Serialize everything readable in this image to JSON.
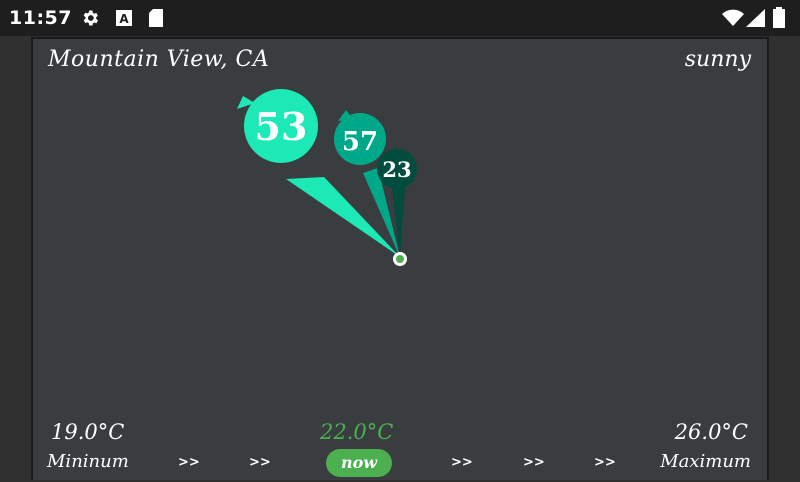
{
  "status_bar": {
    "time": "11:57",
    "icons": [
      "gear-icon",
      "font-a-icon",
      "sd-card-icon",
      "wifi-icon",
      "signal-icon",
      "battery-icon"
    ]
  },
  "weather": {
    "location": "Mountain View, CA",
    "condition": "sunny",
    "pins": [
      {
        "value": "53",
        "color": "#1de9b6"
      },
      {
        "value": "57",
        "color": "#00a88a"
      },
      {
        "value": "23",
        "color": "#004d40"
      }
    ],
    "center_dot_color": "#4caf50",
    "min_temp": "19.0°C",
    "now_temp": "22.0°C",
    "max_temp": "26.0°C",
    "min_label": "Mininum",
    "max_label": "Maximum",
    "now_label": "now",
    "arrow": ">>"
  },
  "colors": {
    "accent": "#4caf50",
    "background": "#3a3d40"
  }
}
